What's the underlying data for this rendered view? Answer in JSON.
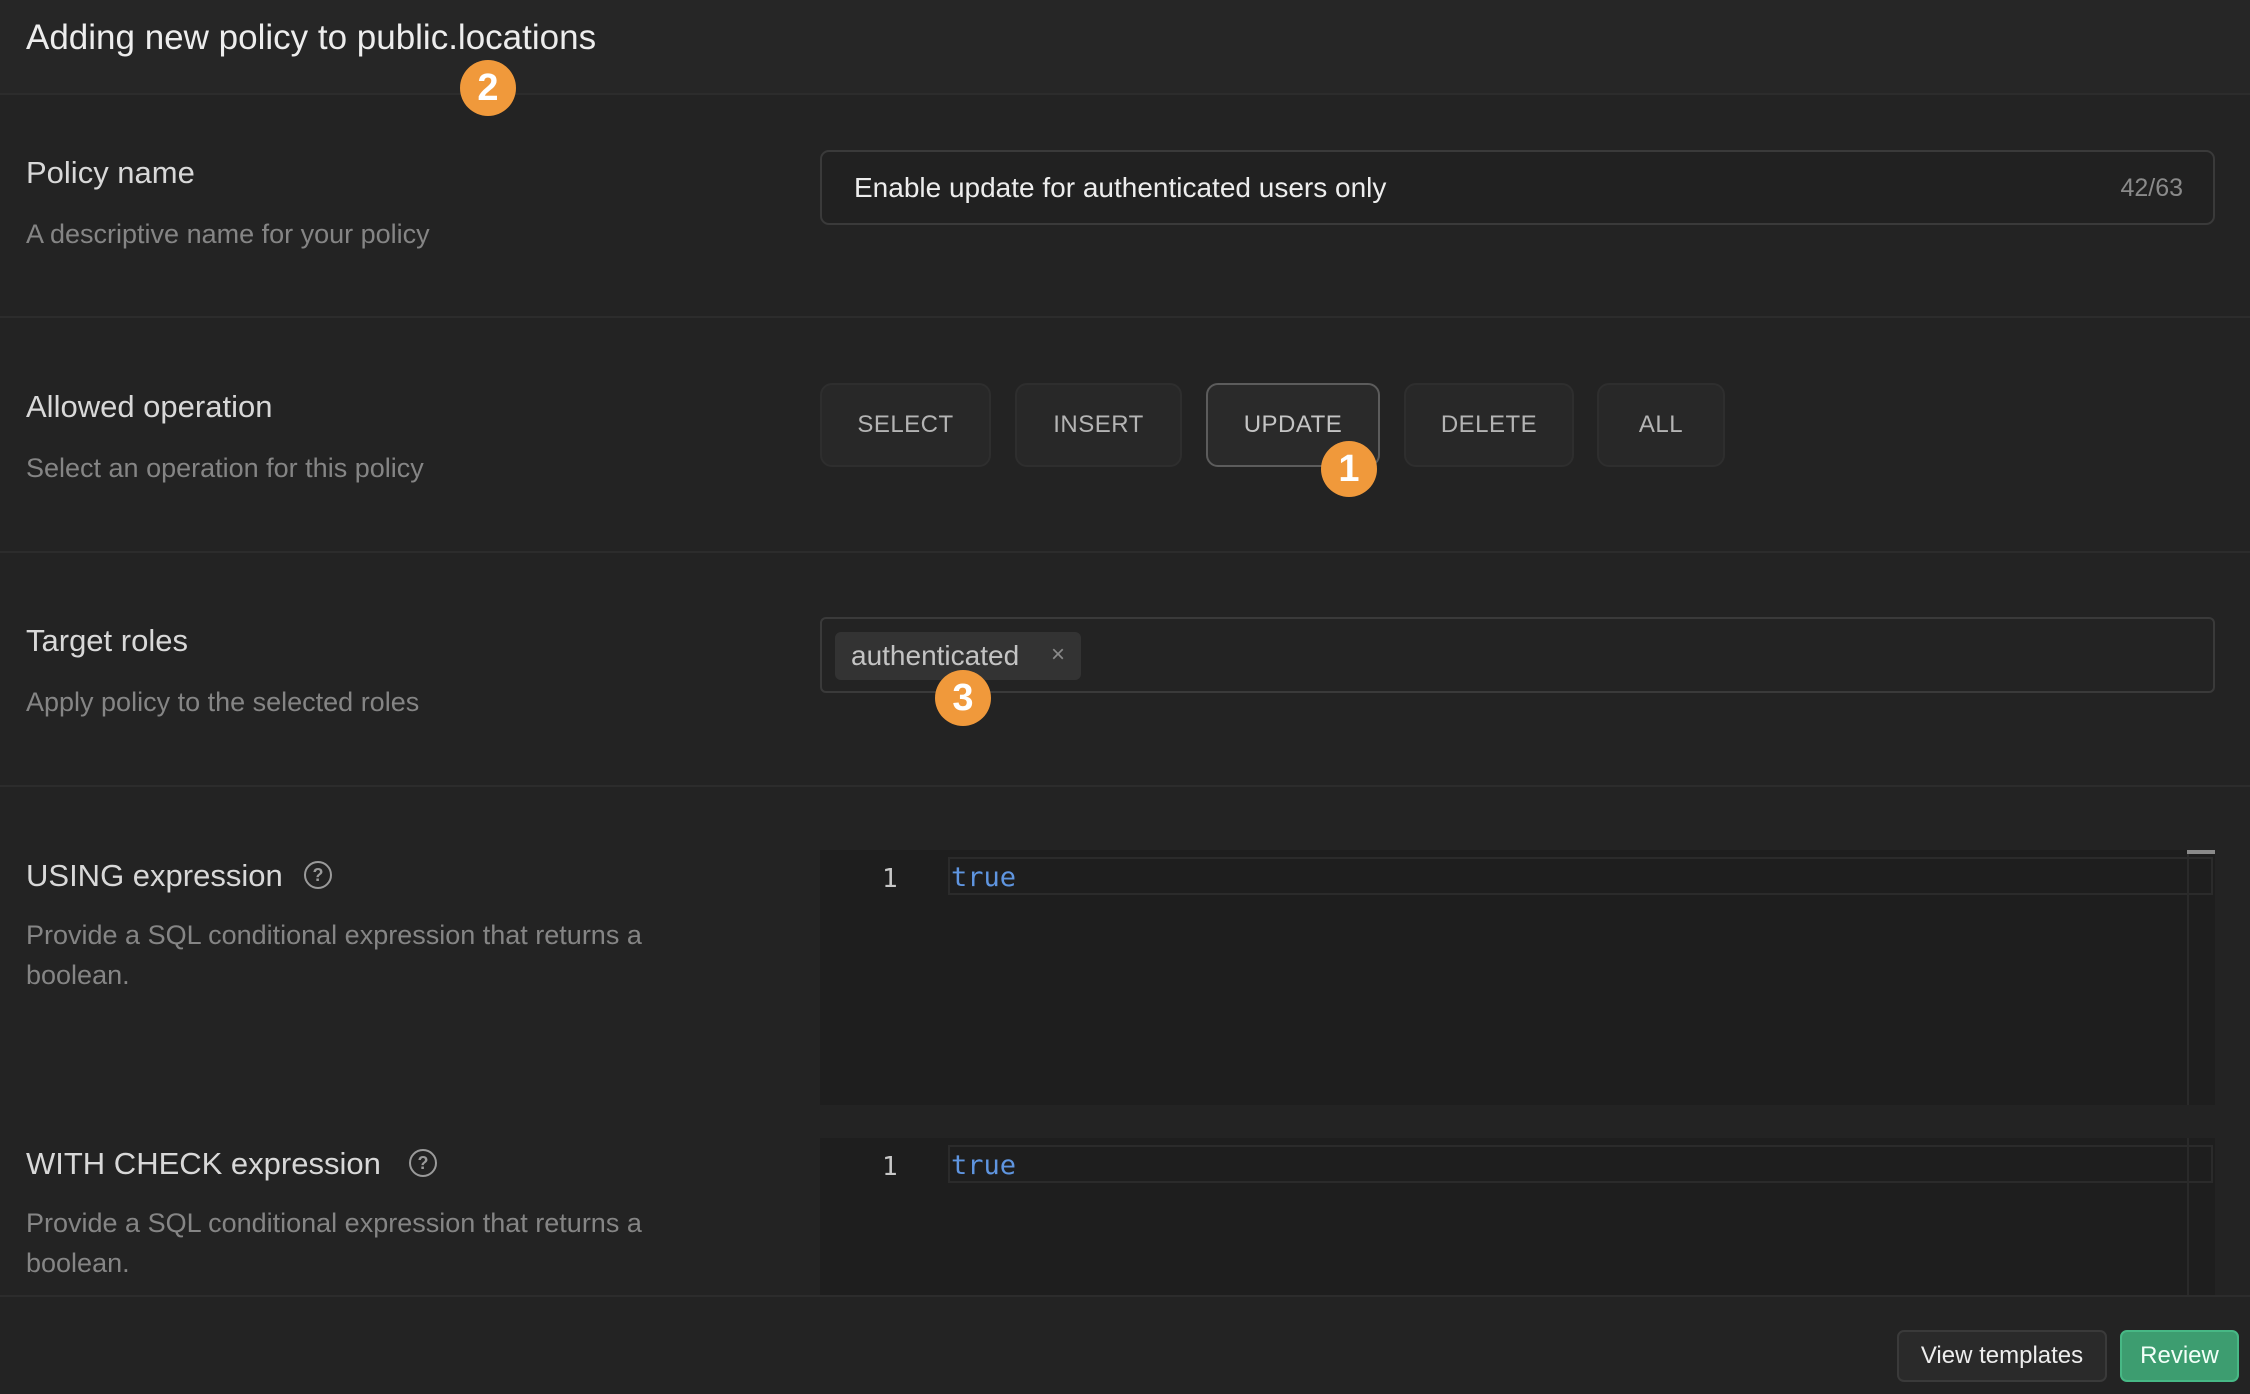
{
  "header": {
    "title": "Adding new policy to public.locations"
  },
  "policy_name": {
    "label": "Policy name",
    "description": "A descriptive name for your policy",
    "value": "Enable update for authenticated users only",
    "char_count": "42/63"
  },
  "allowed_operation": {
    "label": "Allowed operation",
    "description": "Select an operation for this policy",
    "options": [
      "SELECT",
      "INSERT",
      "UPDATE",
      "DELETE",
      "ALL"
    ],
    "selected": "UPDATE"
  },
  "target_roles": {
    "label": "Target roles",
    "description": "Apply policy to the selected roles",
    "roles": [
      "authenticated"
    ],
    "remove_glyph": "×"
  },
  "using_expression": {
    "label": "USING expression",
    "description": "Provide a SQL conditional expression that returns a boolean.",
    "help_icon": "question-circle-icon",
    "line_number": "1",
    "code": "true"
  },
  "with_check_expression": {
    "label": "WITH CHECK expression",
    "description": "Provide a SQL conditional expression that returns a boolean.",
    "help_icon": "question-circle-icon",
    "line_number": "1",
    "code": "true"
  },
  "footer": {
    "view_templates_label": "View templates",
    "review_label": "Review"
  },
  "annotations": {
    "marker_1": "1",
    "marker_2": "2",
    "marker_3": "3"
  },
  "colors": {
    "accent_green": "#3d9d70",
    "marker_orange": "#f0993b",
    "code_keyword": "#5f95e0"
  }
}
